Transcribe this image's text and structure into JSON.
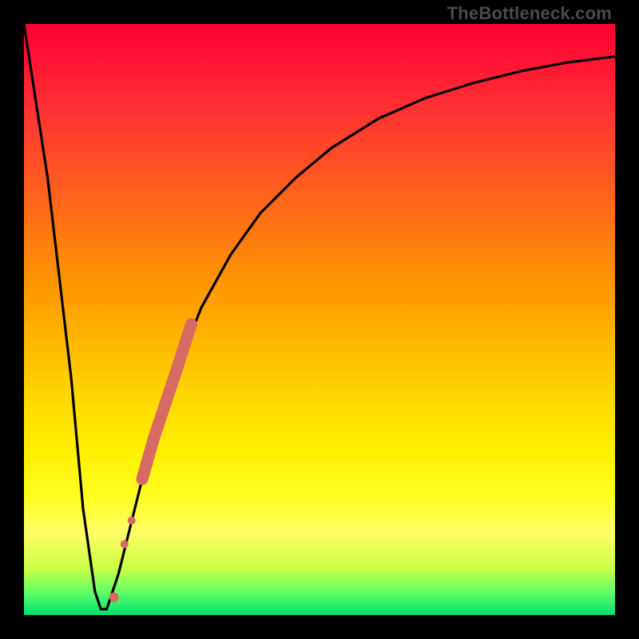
{
  "watermark": "TheBottleneck.com",
  "colors": {
    "curve_stroke": "#000000",
    "series_fill": "#d76a63",
    "background_black": "#000000"
  },
  "chart_data": {
    "type": "line",
    "title": "",
    "xlabel": "",
    "ylabel": "",
    "xlim": [
      0,
      100
    ],
    "ylim": [
      0,
      100
    ],
    "curve": {
      "name": "bottleneck-curve",
      "x": [
        0,
        4,
        8,
        10,
        12,
        13,
        14,
        16,
        18,
        20,
        23,
        26,
        30,
        35,
        40,
        46,
        52,
        60,
        68,
        76,
        84,
        92,
        100
      ],
      "y": [
        100,
        74,
        40,
        18,
        4,
        1,
        1,
        7,
        15,
        23,
        33,
        42,
        52,
        61,
        68,
        74,
        79,
        84,
        87.5,
        90,
        92,
        93.5,
        94.5
      ]
    },
    "series": [
      {
        "name": "highlighted-segment",
        "type": "scatter",
        "render": "thick-path",
        "x": [
          20.0,
          21.0,
          22.0,
          23.0,
          24.0,
          25.0,
          26.0,
          26.8,
          27.6,
          28.3
        ],
        "y": [
          23.0,
          26.5,
          30.0,
          33.0,
          36.0,
          39.0,
          42.0,
          44.5,
          47.0,
          49.2
        ]
      },
      {
        "name": "isolated-points",
        "type": "scatter",
        "render": "dots",
        "points": [
          {
            "x": 17.0,
            "y": 12.0,
            "r": 5
          },
          {
            "x": 18.2,
            "y": 16.0,
            "r": 5
          },
          {
            "x": 15.2,
            "y": 3.0,
            "r": 6
          }
        ]
      }
    ]
  }
}
